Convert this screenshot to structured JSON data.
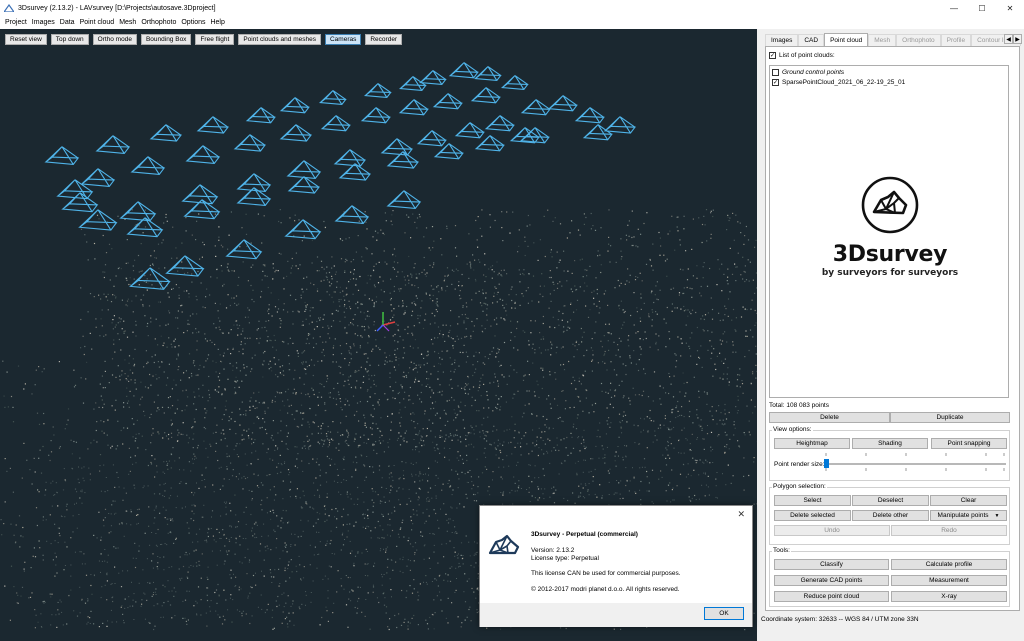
{
  "window": {
    "title": "3Dsurvey (2.13.2) - LAVsurvey [D:\\Projects\\autosave.3Dproject]",
    "controls": [
      "—",
      "☐",
      "✕"
    ]
  },
  "menu": [
    "Project",
    "Images",
    "Data",
    "Point cloud",
    "Mesh",
    "Orthophoto",
    "Options",
    "Help"
  ],
  "toolbar": [
    "Reset view",
    "Top down",
    "Ortho mode",
    "Bounding Box",
    "Free flight",
    "Point clouds and meshes",
    "Cameras",
    "Recorder"
  ],
  "toolbar_active": "Cameras",
  "tabs": [
    "Images",
    "CAD",
    "Point cloud",
    "Mesh",
    "Orthophoto",
    "Profile",
    "Contour lines"
  ],
  "tabs_selected": "Point cloud",
  "tabs_disabled": [
    "Mesh",
    "Orthophoto",
    "Profile",
    "Contour lines"
  ],
  "pointcloud": {
    "list_label": "List of point clouds:",
    "list_label_checked": true,
    "items": [
      {
        "label": "Ground control points",
        "checked": false,
        "italic": true
      },
      {
        "label": "SparsePointCloud_2021_06_22-19_25_01",
        "checked": true,
        "italic": false
      }
    ],
    "total": "Total: 108 083 points",
    "delete_label": "Delete",
    "duplicate_label": "Duplicate"
  },
  "logo": {
    "brand": "3Dsurvey",
    "tagline": "by surveyors for surveyors"
  },
  "view_options": {
    "label": "View options:",
    "heightmap": "Heightmap",
    "shading": "Shading",
    "snapping": "Point snapping",
    "render_size_label": "Point render size:",
    "render_size_level": 0.0
  },
  "polygon": {
    "label": "Polygon selection:",
    "select": "Select",
    "deselect": "Deselect",
    "clear": "Clear",
    "delete_selected": "Delete selected",
    "delete_other": "Delete other",
    "manipulate": "Manipulate points",
    "undo": "Undo",
    "redo": "Redo"
  },
  "tools": {
    "label": "Tools:",
    "classify": "Classify",
    "calculate_profile": "Calculate profile",
    "generate_cad": "Generate CAD points",
    "measurement": "Measurement",
    "reduce": "Reduce point cloud",
    "xray": "X-ray"
  },
  "status": {
    "coordinate_system": "Coordinate system: 32633 -- WGS 84 / UTM zone 33N"
  },
  "dialog": {
    "title": "3Dsurvey - Perpetual (commercial)",
    "version": "Version: 2.13.2",
    "license_type": "License type: Perpetual",
    "commercial_note": "This license CAN be used for commercial purposes.",
    "copyright": "© 2012-2017 modri planet d.o.o. All rights reserved.",
    "ok_label": "OK",
    "close_glyph": "✕"
  },
  "colors": {
    "viewport_bg": "#1b2830",
    "camera_frustum": "#4fb3e8",
    "accent": "#0078d7"
  }
}
